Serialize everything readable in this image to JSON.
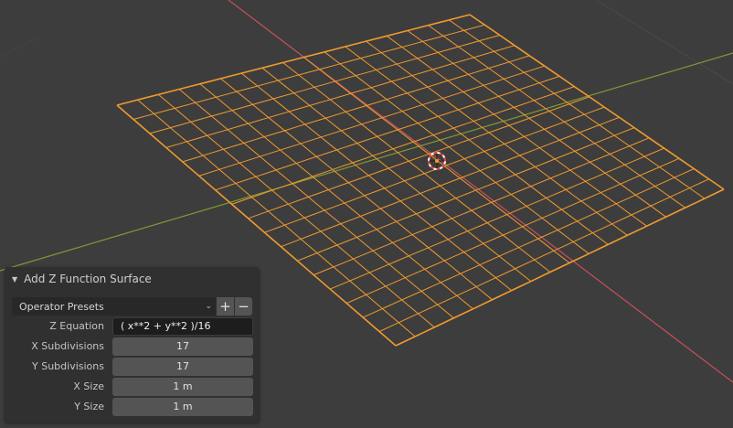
{
  "panel": {
    "title": "Add Z Function Surface",
    "presets_label": "Operator Presets",
    "add_preset": "+",
    "remove_preset": "−",
    "properties": [
      {
        "label": "Z Equation",
        "value": "( x**2 + y**2 )/16"
      },
      {
        "label": "X Subdivisions",
        "value": "17"
      },
      {
        "label": "Y Subdivisions",
        "value": "17"
      },
      {
        "label": "X Size",
        "value": "1 m"
      },
      {
        "label": "Y Size",
        "value": "1 m"
      }
    ]
  },
  "viewport": {
    "mesh_subdivisions": 17,
    "colors": {
      "background": "#3d3d3d",
      "mesh": "#f09a2e",
      "x_axis": "#c8505a",
      "y_axis": "#7f9a35",
      "grid": "#4a4a4a"
    }
  }
}
